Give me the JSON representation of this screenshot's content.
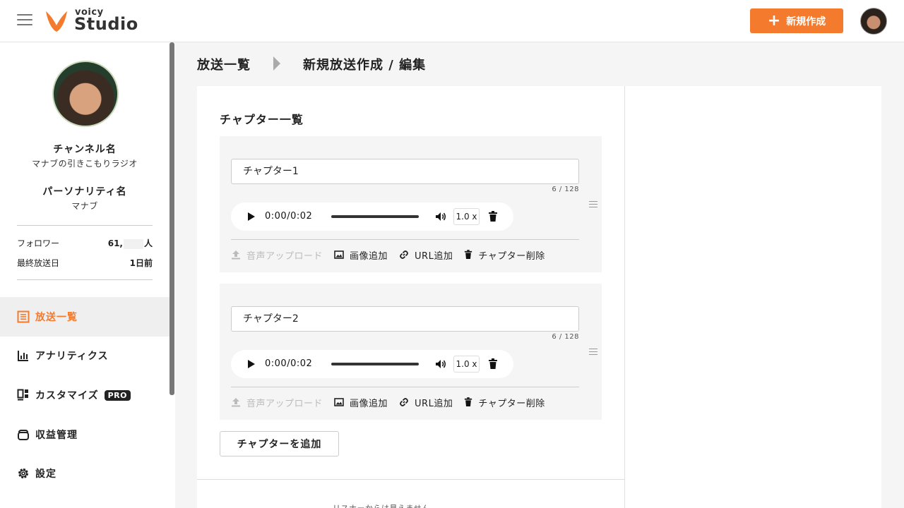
{
  "header": {
    "logo_small": "voicy",
    "logo_big": "Studio",
    "new_button_label": "新規作成",
    "brand_color": "#f47a2e"
  },
  "sidebar": {
    "channel_label": "チャンネル名",
    "channel_name": "マナブの引きこもりラジオ",
    "personality_label": "パーソナリティ名",
    "personality_name": "マナブ",
    "stats": {
      "followers_label": "フォロワー",
      "followers_prefix": "61,",
      "followers_suffix": "人",
      "last_broadcast_label": "最終放送日",
      "last_broadcast_value": "1日前"
    },
    "nav": [
      {
        "label": "放送一覧",
        "icon": "list-icon",
        "active": true
      },
      {
        "label": "アナリティクス",
        "icon": "bar-chart-icon",
        "active": false
      },
      {
        "label": "カスタマイズ",
        "icon": "customize-icon",
        "active": false,
        "badge": "PRO"
      },
      {
        "label": "収益管理",
        "icon": "wallet-icon",
        "active": false
      },
      {
        "label": "設定",
        "icon": "gear-icon",
        "active": false
      }
    ]
  },
  "breadcrumb": {
    "parent": "放送一覧",
    "current": "新規放送作成 / 編集"
  },
  "main": {
    "section_title": "チャプター一覧",
    "chapters": [
      {
        "title": "チャプター1",
        "char_count": "6 / 128",
        "time": "0:00/0:02",
        "speed": "1.0 x"
      },
      {
        "title": "チャプター2",
        "char_count": "6 / 128",
        "time": "0:00/0:02",
        "speed": "1.0 x"
      }
    ],
    "actions": {
      "upload": "音声アップロード",
      "add_image": "画像追加",
      "add_url": "URL追加",
      "delete_chapter": "チャプター削除"
    },
    "add_chapter_label": "チャプターを追加",
    "listener_note": "リスナーからは見えません"
  }
}
